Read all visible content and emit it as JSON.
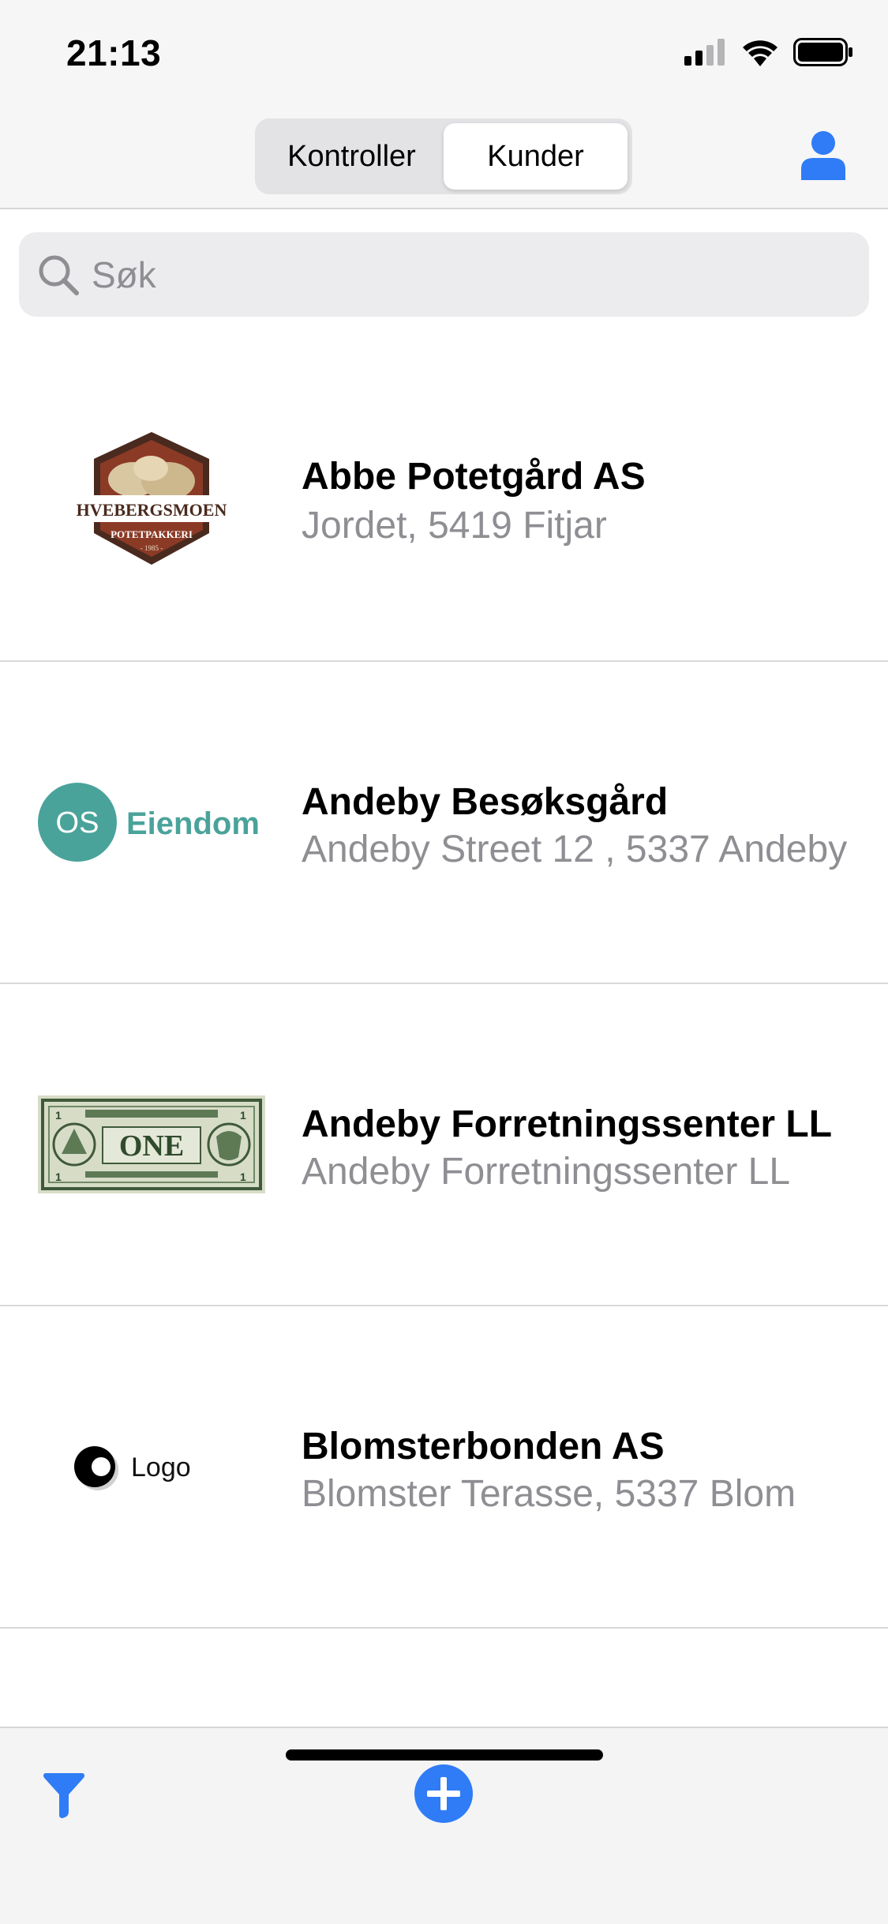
{
  "status_bar": {
    "time": "21:13"
  },
  "segmented": {
    "items": [
      {
        "label": "Kontroller"
      },
      {
        "label": "Kunder"
      }
    ],
    "selected": "Kunder"
  },
  "search": {
    "placeholder": "Søk"
  },
  "customers": [
    {
      "name": "Abbe Potetgård AS",
      "address": "Jordet, 5419 Fitjar",
      "logo": {
        "type": "hvebergsmoen",
        "line1": "HVEBERGSMOEN",
        "line2": "POTETPAKKERI",
        "line3": "- 1985 -"
      }
    },
    {
      "name": "Andeby Besøksgård",
      "address": "Andeby Street 12  , 5337 Andeby",
      "logo": {
        "type": "os-eiendom",
        "badge": "OS",
        "word": "Eiendom"
      }
    },
    {
      "name": "Andeby Forretningssenter LL",
      "address": "Andeby Forretningssenter LL",
      "logo": {
        "type": "dollar-bill",
        "word": "ONE"
      }
    },
    {
      "name": "Blomsterbonden AS",
      "address": "Blomster Terasse, 5337 Blom",
      "logo": {
        "type": "logo-text",
        "word": "Logo"
      }
    }
  ],
  "colors": {
    "accent": "#2f7cf6",
    "teal": "#4aa39a",
    "secondary_text": "#8e8e93"
  },
  "icons": {
    "profile": "person-icon",
    "filter": "filter-icon",
    "add": "add-circle-icon",
    "search": "search-icon"
  }
}
